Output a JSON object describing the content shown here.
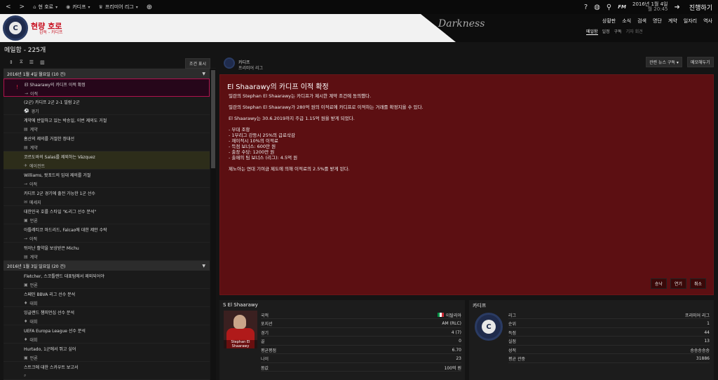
{
  "topbar": {
    "back": "<",
    "forward": ">",
    "menu_items": [
      "현 호로",
      "카디프",
      "프리미어 리그"
    ],
    "date_line1": "2016년 1월 4일",
    "date_line2": "월 20:45",
    "fm_label": "FM",
    "continue_label": "진행하기"
  },
  "header": {
    "manager_name": "현량 호로",
    "manager_sub": "감독 - 카디프",
    "skin_logo": "Darkness",
    "crest_letter": "C",
    "nav": [
      "상황판",
      "소식",
      "검색",
      "명단",
      "계약",
      "일자리",
      "역사"
    ],
    "subnav": [
      "메일함",
      "일정",
      "구독",
      "기자 회견"
    ]
  },
  "inbox": {
    "title": "메일함 - 225개",
    "filter_button": "조건 표시",
    "groups": [
      {
        "label": "2016년 1월 4일 월요일 (10 건)",
        "items": [
          {
            "title": "El Shaarawy의 카디프 이적 확정",
            "type": "이적",
            "icon": "transfer-icon",
            "state": "selected"
          },
          {
            "title": "(2군) 카디프 2군 2-1 빌럼 2군",
            "type": "경기",
            "icon": "match-icon",
            "state": "normal"
          },
          {
            "title": "계약에 반발하고 있는 박승일, 이번 제의도 거절",
            "type": "계약",
            "icon": "contract-icon",
            "state": "normal"
          },
          {
            "title": "홈산의 제의를 거절한 정대선",
            "type": "계약",
            "icon": "contract-icon",
            "state": "normal"
          },
          {
            "title": "코르도바의 Salas를 제외하는 Vázquez",
            "type": "에이전트",
            "icon": "agent-icon",
            "state": "highlight"
          },
          {
            "title": "Williams, 왓포드의 임대 제의를 거절",
            "type": "이적",
            "icon": "transfer-icon",
            "state": "normal"
          },
          {
            "title": "카디프 2군 경기에 출전 가능한 1군 선수",
            "type": "메세지",
            "icon": "message-icon",
            "state": "normal"
          },
          {
            "title": "대한민국 호를 스타일 \"K-리그 선수 분석\"",
            "type": "언론",
            "icon": "press-icon",
            "state": "normal"
          },
          {
            "title": "아틀레티코 마드리드, Falcao에 대한 제안 수락",
            "type": "이적",
            "icon": "transfer-icon",
            "state": "normal"
          },
          {
            "title": "뒤이난 활약을 보상받은 Michu",
            "type": "계약",
            "icon": "contract-icon",
            "state": "normal"
          }
        ]
      },
      {
        "label": "2016년 1월 3일 일요일 (20 건)",
        "items": [
          {
            "title": "Fletcher, 스코틀랜드 대표팀에서 제외되어야",
            "type": "언론",
            "icon": "press-icon",
            "state": "normal"
          },
          {
            "title": "스페인 BBVA 리그 선수 분석",
            "type": "대회",
            "icon": "competition-icon",
            "state": "normal"
          },
          {
            "title": "잉글랜드 챔피언십 선수 분석",
            "type": "대회",
            "icon": "competition-icon",
            "state": "normal"
          },
          {
            "title": "UEFA Europa League 선수 분석",
            "type": "대회",
            "icon": "competition-icon",
            "state": "normal"
          },
          {
            "title": "Hurtado, 1군에서 뛰고 싶어",
            "type": "언론",
            "icon": "press-icon",
            "state": "normal"
          },
          {
            "title": "스트크에 대한 스카우트 보고서",
            "type": "",
            "icon": "scout-icon",
            "state": "normal"
          }
        ]
      }
    ]
  },
  "message": {
    "sender_name": "카디프",
    "sender_sub": "프리미어 리그",
    "btn_news": "관련 뉴스 구독",
    "btn_memo": "메모해두기",
    "title": "El Shaarawy의 카디프 이적 확정",
    "paragraphs": [
      "밀란의 Stephan El Shaarawy는 카디프가 제시한 계약 조건에 동의했다.",
      "밀란의 Stephan El Shaarawy가 280억 원의 이적료에 카디프로 이적하는 거래를 확정지을 수 있다.",
      "El Shaarawy는 30.6.2019까지 주급 1.15억 원을 받게 되었다."
    ],
    "bullets": [
      "- 부대 조항",
      "- 1부리그 강등시 25%의 급료삭감",
      "- 재이적시 10%의 이적료",
      "- 득점 보너스: 600만 원",
      "- 출장 수당: 1200만 원",
      "- 출매의 팀 보너스 (리그): 4.5억 원"
    ],
    "footer_para": "제노아는 연대 기여금 제도에 의해 이적료의 2.5%를 받게 된다.",
    "actions": [
      "승낙",
      "연기",
      "취소"
    ]
  },
  "player_card": {
    "title": "S El Shaarawy",
    "photo_caption": "Stephan El Shaarawy",
    "rows": [
      {
        "k": "국적",
        "v": "이탈리아",
        "flag": true
      },
      {
        "k": "포지션",
        "v": "AM (RLC)"
      },
      {
        "k": "경기",
        "v": "4 (7)"
      },
      {
        "k": "골",
        "v": "0"
      },
      {
        "k": "평균평점",
        "v": "6.70"
      },
      {
        "k": "나이",
        "v": "23"
      },
      {
        "k": "몸값",
        "v": "100억 원"
      }
    ]
  },
  "club_card": {
    "title": "카디프",
    "crest_letter": "C",
    "rows": [
      {
        "k": "리그",
        "v": "프리미어 리그"
      },
      {
        "k": "순위",
        "v": "1"
      },
      {
        "k": "득점",
        "v": "44"
      },
      {
        "k": "실점",
        "v": "13"
      },
      {
        "k": "성적",
        "v": "승승승승승"
      },
      {
        "k": "평균 관중",
        "v": "31886"
      }
    ]
  }
}
